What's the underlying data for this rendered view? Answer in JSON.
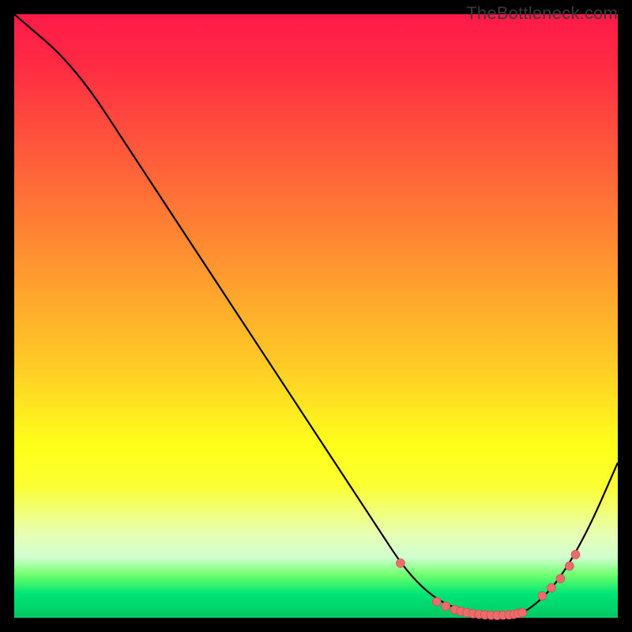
{
  "watermark": "TheBottleneck.com",
  "colors": {
    "curve": "#000000",
    "dot": "#ee6b6b",
    "dot_stroke": "#c94a4a"
  },
  "chart_data": {
    "type": "line",
    "title": "",
    "xlabel": "",
    "ylabel": "",
    "xlim": [
      0,
      100
    ],
    "ylim": [
      0,
      105
    ],
    "series": [
      {
        "name": "bottleneck-curve",
        "x": [
          0,
          10,
          20,
          30,
          40,
          50,
          60,
          65,
          70,
          75,
          78,
          80,
          82,
          85,
          90,
          95,
          100
        ],
        "y": [
          105,
          96,
          80,
          64,
          48,
          32,
          16,
          8,
          3,
          1,
          0.5,
          0.4,
          0.5,
          1,
          6,
          15,
          27
        ]
      }
    ],
    "dots": {
      "name": "highlighted-points",
      "x": [
        64,
        70,
        71.5,
        73,
        74,
        75,
        76,
        77,
        78,
        79,
        80,
        81,
        82,
        82.8,
        83.5,
        84.2,
        87.5,
        89,
        90.5,
        92,
        93
      ],
      "y": [
        9.5,
        2.8,
        2.0,
        1.4,
        1.1,
        0.9,
        0.7,
        0.6,
        0.5,
        0.45,
        0.4,
        0.45,
        0.5,
        0.6,
        0.75,
        0.9,
        3.8,
        5.2,
        6.8,
        9.0,
        11.0
      ]
    }
  }
}
